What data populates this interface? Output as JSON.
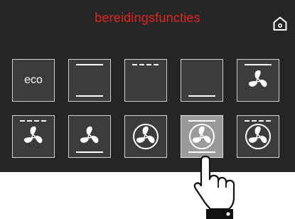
{
  "header": {
    "title": "bereidingsfuncties",
    "title_color": "#e0261f",
    "home_icon": "home-icon"
  },
  "functions": [
    {
      "id": "eco",
      "label": "eco",
      "icon": "eco-text",
      "top": "none",
      "bottom": "none",
      "fan": "none"
    },
    {
      "id": "top-bottom-heat",
      "icon": "top-bottom-heating-icon",
      "top": "solid",
      "bottom": "solid",
      "fan": "none"
    },
    {
      "id": "top-heat",
      "icon": "top-heating-icon",
      "top": "dashed",
      "bottom": "none",
      "fan": "none"
    },
    {
      "id": "bottom-heat",
      "icon": "bottom-heating-icon",
      "top": "none",
      "bottom": "solid",
      "fan": "none"
    },
    {
      "id": "fan-only",
      "icon": "fan-icon",
      "top": "solid",
      "bottom": "none",
      "fan": "plain"
    },
    {
      "id": "grill-fan",
      "icon": "grill-fan-icon",
      "top": "dashed",
      "bottom": "none",
      "fan": "plain"
    },
    {
      "id": "bottom-fan",
      "icon": "bottom-heat-fan-icon",
      "top": "none",
      "bottom": "solid",
      "fan": "plain"
    },
    {
      "id": "hot-air",
      "icon": "hot-air-icon",
      "top": "none",
      "bottom": "none",
      "fan": "ring"
    },
    {
      "id": "hot-air-bottom",
      "icon": "hot-air-bottom-heat-icon",
      "top": "solid",
      "bottom": "solid",
      "fan": "ring"
    },
    {
      "id": "hot-air-grill",
      "icon": "hot-air-grill-icon",
      "top": "dashed",
      "bottom": "none",
      "fan": "ring"
    }
  ],
  "selected": "hot-air-bottom"
}
